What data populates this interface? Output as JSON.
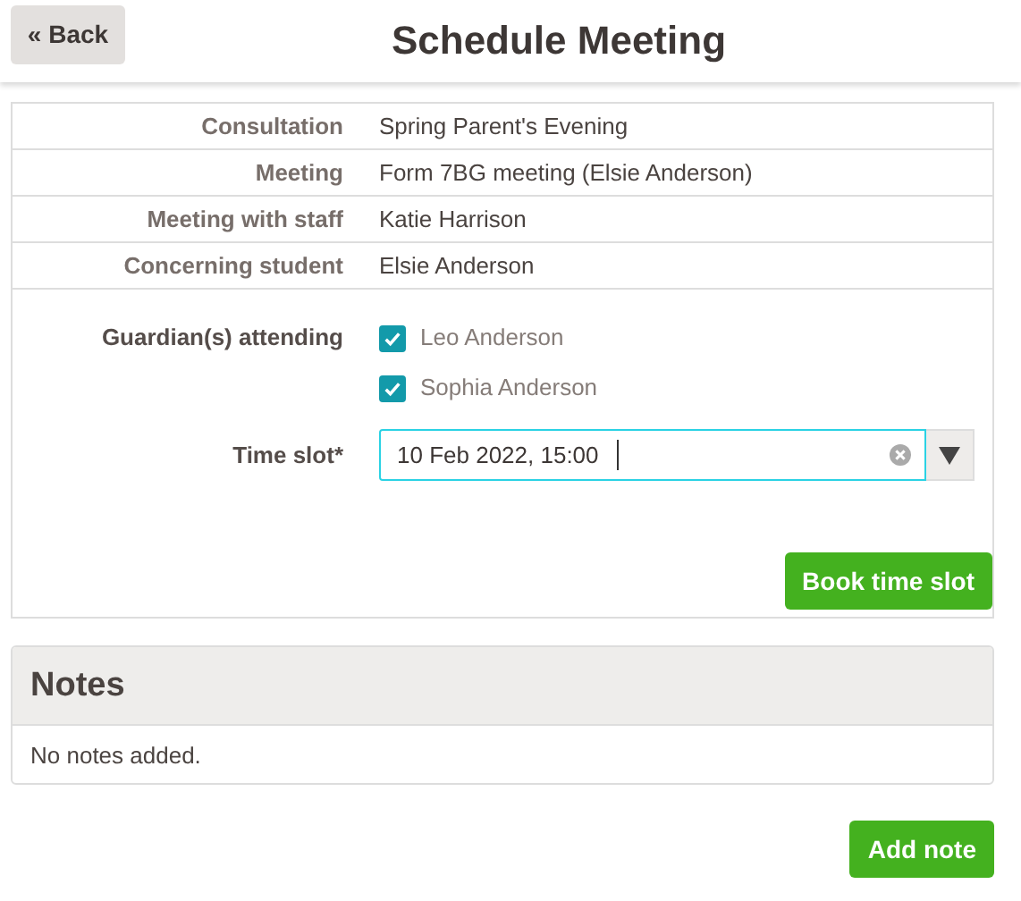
{
  "header": {
    "back_button": "« Back",
    "title": "Schedule Meeting"
  },
  "details": [
    {
      "label": "Consultation",
      "value": "Spring Parent's Evening"
    },
    {
      "label": "Meeting",
      "value": "Form 7BG meeting (Elsie Anderson)"
    },
    {
      "label": "Meeting with staff",
      "value": "Katie Harrison"
    },
    {
      "label": "Concerning student",
      "value": "Elsie Anderson"
    }
  ],
  "guardians": {
    "label": "Guardian(s) attending",
    "options": [
      {
        "name": "Leo Anderson",
        "checked": true
      },
      {
        "name": "Sophia Anderson",
        "checked": true
      }
    ]
  },
  "time_slot": {
    "label": "Time slot*",
    "value": "10 Feb 2022, 15:00"
  },
  "book_button": "Book time slot",
  "notes": {
    "title": "Notes",
    "empty_text": "No notes added."
  },
  "add_note_button": "Add note"
}
